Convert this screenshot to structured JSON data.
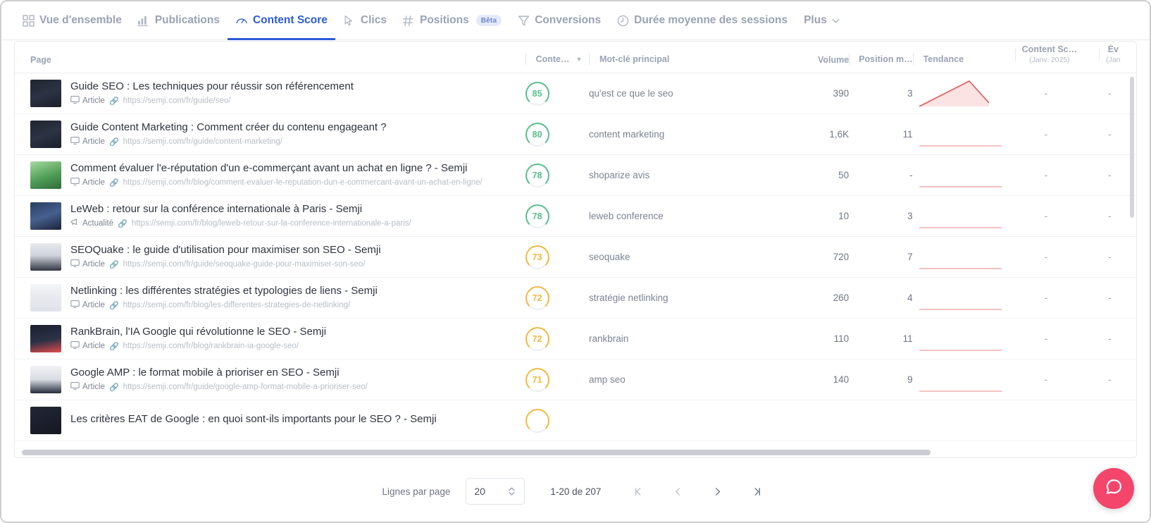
{
  "nav": {
    "items": [
      {
        "label": "Vue d'ensemble",
        "icon": "grid-icon",
        "active": false,
        "badge": ""
      },
      {
        "label": "Publications",
        "icon": "bar-chart-icon",
        "active": false,
        "badge": ""
      },
      {
        "label": "Content Score",
        "icon": "gauge-icon",
        "active": true,
        "badge": ""
      },
      {
        "label": "Clics",
        "icon": "cursor-icon",
        "active": false,
        "badge": ""
      },
      {
        "label": "Positions",
        "icon": "hash-icon",
        "active": false,
        "badge": "Bêta"
      },
      {
        "label": "Conversions",
        "icon": "funnel-icon",
        "active": false,
        "badge": ""
      },
      {
        "label": "Durée moyenne des sessions",
        "icon": "clock-icon",
        "active": false,
        "badge": ""
      }
    ],
    "more_label": "Plus",
    "more_icon": "chevron-down-icon",
    "active_color": "#2b5bd7",
    "inactive_color": "#9aa3b4"
  },
  "table": {
    "headers": {
      "page": "Page",
      "content_score": "Conte…",
      "sort_icon": "sort-descending-icon",
      "main_keyword": "Mot-clé principal",
      "volume": "Volume",
      "position": "Position m…",
      "trend": "Tendance",
      "content_score_month": "Content Sc…",
      "content_score_month_sub": "(Janv. 2025)",
      "evolution": "Év",
      "evolution_sub": "(Jan"
    },
    "rows": [
      {
        "title": "Guide SEO : Les techniques pour réussir son référencement",
        "type": "Article",
        "type_icon": "monitor-icon",
        "url": "https://semji.com/fr/guide/seo/",
        "score": "85",
        "score_color": "#55c08a",
        "keyword": "qu'est ce que le seo",
        "volume": "390",
        "position": "3",
        "trend": "peak",
        "content_score_month": "-",
        "evolution": "-",
        "thumb": "dark-logo"
      },
      {
        "title": "Guide Content Marketing : Comment créer du contenu engageant ?",
        "type": "Article",
        "type_icon": "monitor-icon",
        "url": "https://semji.com/fr/guide/content-marketing/",
        "score": "80",
        "score_color": "#55c08a",
        "keyword": "content marketing",
        "volume": "1,6K",
        "position": "11",
        "trend": "flat",
        "content_score_month": "-",
        "evolution": "-",
        "thumb": "dark-logo"
      },
      {
        "title": "Comment évaluer l'e-réputation d'un e-commerçant avant un achat en ligne ? - Semji",
        "type": "Article",
        "type_icon": "monitor-icon",
        "url": "https://semji.com/fr/blog/comment-evaluer-le-reputation-dun-e-commercant-avant-un-achat-en-ligne/",
        "score": "78",
        "score_color": "#55c08a",
        "keyword": "shoparize avis",
        "volume": "50",
        "position": "-",
        "trend": "flat",
        "content_score_month": "-",
        "evolution": "-",
        "thumb": "green-photo"
      },
      {
        "title": "LeWeb : retour sur la conférence internationale à Paris - Semji",
        "type": "Actualité",
        "type_icon": "megaphone-icon",
        "url": "https://semji.com/fr/blog/leweb-retour-sur-la-conference-internationale-a-paris/",
        "score": "78",
        "score_color": "#55c08a",
        "keyword": "leweb conference",
        "volume": "10",
        "position": "3",
        "trend": "flat",
        "content_score_month": "-",
        "evolution": "-",
        "thumb": "blue-photo"
      },
      {
        "title": "SEOQuake : le guide d'utilisation pour maximiser son SEO - Semji",
        "type": "Article",
        "type_icon": "monitor-icon",
        "url": "https://semji.com/fr/guide/seoquake-guide-pour-maximiser-son-seo/",
        "score": "73",
        "score_color": "#f0b93f",
        "keyword": "seoquake",
        "volume": "720",
        "position": "7",
        "trend": "flat",
        "content_score_month": "-",
        "evolution": "-",
        "thumb": "grey-screen"
      },
      {
        "title": "Netlinking : les différentes stratégies et typologies de liens - Semji",
        "type": "Article",
        "type_icon": "monitor-icon",
        "url": "https://semji.com/fr/blog/les-differentes-strategies-de-netlinking/",
        "score": "72",
        "score_color": "#f0b93f",
        "keyword": "stratégie netlinking",
        "volume": "260",
        "position": "4",
        "trend": "flat",
        "content_score_month": "-",
        "evolution": "-",
        "thumb": "light-chart"
      },
      {
        "title": "RankBrain, l'IA Google qui révolutionne le SEO - Semji",
        "type": "Article",
        "type_icon": "monitor-icon",
        "url": "https://semji.com/fr/blog/rankbrain-ia-google-seo/",
        "score": "72",
        "score_color": "#f0b93f",
        "keyword": "rankbrain",
        "volume": "110",
        "position": "11",
        "trend": "flat",
        "content_score_month": "-",
        "evolution": "-",
        "thumb": "red-dark"
      },
      {
        "title": "Google AMP : le format mobile à prioriser en SEO - Semji",
        "type": "Article",
        "type_icon": "monitor-icon",
        "url": "https://semji.com/fr/guide/google-amp-format-mobile-a-prioriser-seo/",
        "score": "71",
        "score_color": "#f0b93f",
        "keyword": "amp seo",
        "volume": "140",
        "position": "9",
        "trend": "flat",
        "content_score_month": "-",
        "evolution": "-",
        "thumb": "phones"
      },
      {
        "title": "Les critères EAT de Google : en quoi sont-ils importants pour le SEO ? - Semji",
        "type": "",
        "type_icon": "",
        "url": "",
        "score": "",
        "score_color": "#f0b93f",
        "keyword": "",
        "volume": "",
        "position": "",
        "trend": "none",
        "content_score_month": "",
        "evolution": "",
        "thumb": "dark-photo"
      }
    ]
  },
  "footer": {
    "rows_per_page_label": "Lignes par page",
    "rows_per_page_value": "20",
    "range": "1-20 de 207",
    "first_icon": "first-page-icon",
    "prev_icon": "previous-page-icon",
    "next_icon": "next-page-icon",
    "last_icon": "last-page-icon"
  },
  "chat": {
    "icon": "chat-bubble-icon",
    "color": "#f4456b"
  }
}
